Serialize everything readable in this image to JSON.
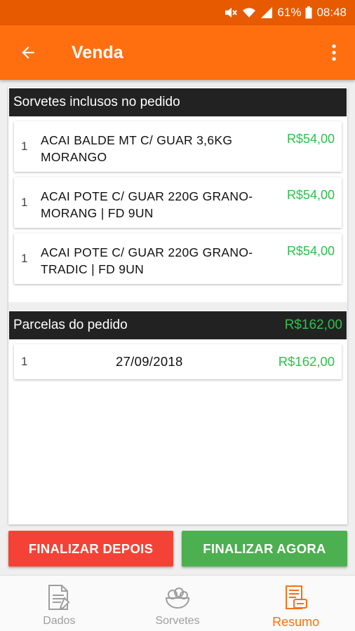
{
  "status_bar": {
    "battery": "61%",
    "time": "08:48"
  },
  "app_bar": {
    "title": "Venda"
  },
  "items_section": {
    "header": "Sorvetes inclusos no pedido",
    "items": [
      {
        "qty": "1",
        "description": "ACAI BALDE MT C/ GUAR 3,6KG MORANGO",
        "price": "R$54,00"
      },
      {
        "qty": "1",
        "description": "ACAI POTE C/ GUAR 220G GRANO-MORANG | FD 9UN",
        "price": "R$54,00"
      },
      {
        "qty": "1",
        "description": "ACAI POTE C/ GUAR 220G GRANO-TRADIC | FD 9UN",
        "price": "R$54,00"
      }
    ]
  },
  "parcels_section": {
    "header": "Parcelas do pedido",
    "total": "R$162,00",
    "parcels": [
      {
        "number": "1",
        "date": "27/09/2018",
        "value": "R$162,00"
      }
    ]
  },
  "actions": {
    "later_label": "FINALIZAR DEPOIS",
    "now_label": "FINALIZAR AGORA"
  },
  "bottom_nav": {
    "items": [
      {
        "label": "Dados",
        "icon": "document-icon",
        "active": false
      },
      {
        "label": "Sorvetes",
        "icon": "ice-cream-bowl-icon",
        "active": false
      },
      {
        "label": "Resumo",
        "icon": "receipt-icon",
        "active": true
      }
    ]
  },
  "colors": {
    "primary": "#ff6f10",
    "status_bar": "#e85a00",
    "price_green": "#2ec04a",
    "later_red": "#f44336",
    "now_green": "#4caf50"
  }
}
